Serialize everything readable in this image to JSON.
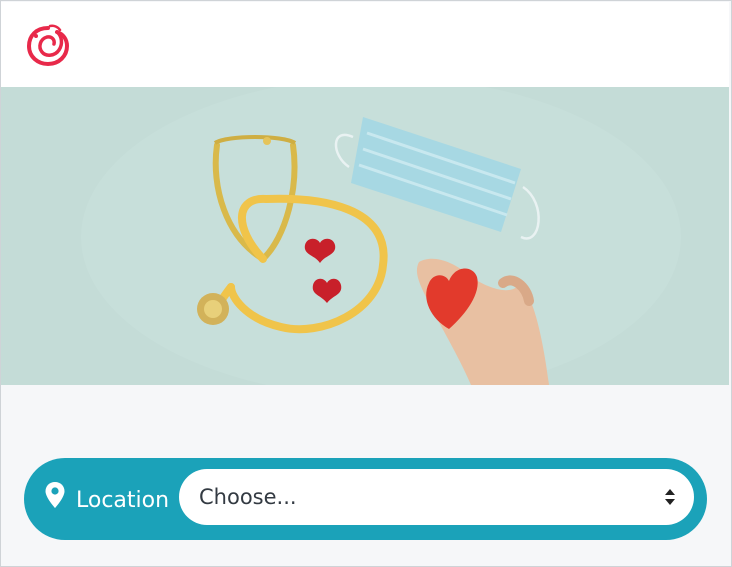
{
  "header": {
    "logo_icon": "swirl-logo-icon",
    "brand_color": "#e8294a"
  },
  "hero": {
    "image": "healthcare-banner",
    "background_color": "#c4dcd7"
  },
  "location_search": {
    "icon": "map-pin-icon",
    "label": "Location",
    "select_value": "Choose...",
    "accent_color": "#1ba2b9"
  }
}
